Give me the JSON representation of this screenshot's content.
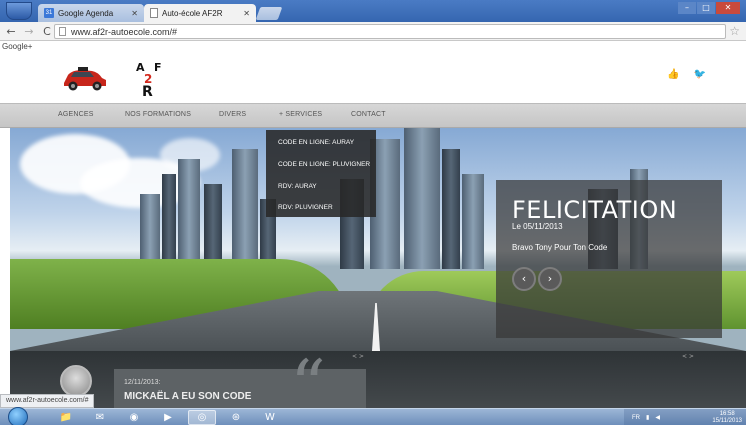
{
  "browser": {
    "tabs": [
      {
        "title": "Google Agenda",
        "favicon": "calendar-icon",
        "active": false
      },
      {
        "title": "Auto-école AF2R",
        "favicon": "page-icon",
        "active": true
      }
    ],
    "url": "www.af2r-autoecole.com/#",
    "bookmark_label": "Google+",
    "status_url": "www.af2r-autoecole.com/#"
  },
  "site": {
    "logo_text": "AF2R",
    "nav": [
      "AGENCES",
      "NOS FORMATIONS",
      "DIVERS",
      "+ SERVICES",
      "CONTACT"
    ],
    "services_menu": [
      "CODE EN LIGNE: AURAY",
      "CODE EN LIGNE: PLUVIGNER",
      "RDV: AURAY",
      "RDV: PLUVIGNER"
    ],
    "slide": {
      "title": "FELICITATION",
      "date": "Le 05/11/2013",
      "text": "Bravo Tony Pour Ton Code",
      "prev": "‹",
      "next": "›"
    },
    "pager_left": "< >",
    "pager_right": "< >",
    "news": {
      "date": "12/11/2013:",
      "title": "MICKAËL A EU SON CODE"
    },
    "colors": {
      "nav_bg": "#cfcfcf",
      "dropdown_bg": "#282828",
      "caption_bg": "#373737"
    }
  },
  "taskbar": {
    "buttons": [
      "explorer-icon",
      "outlook-icon",
      "firefox-icon",
      "media-player-icon",
      "chrome-icon",
      "network-icon",
      "word-icon"
    ],
    "lang": "FR",
    "time": "16:58",
    "date": "15/11/2013"
  }
}
